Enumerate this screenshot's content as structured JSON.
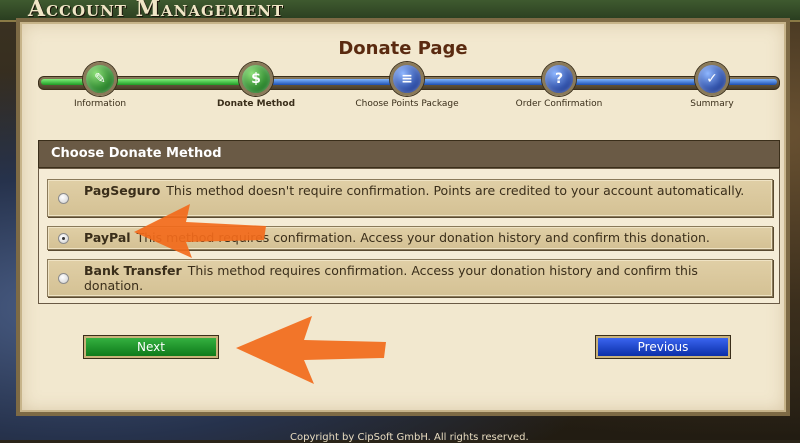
{
  "app": {
    "banner_title": "Account Management"
  },
  "page": {
    "title": "Donate Page"
  },
  "steps": [
    {
      "label": "Information",
      "icon": "quill-icon",
      "active": false
    },
    {
      "label": "Donate Method",
      "icon": "coin-icon",
      "active": true
    },
    {
      "label": "Choose Points Package",
      "icon": "scroll-icon",
      "active": false
    },
    {
      "label": "Order Confirmation",
      "icon": "question-icon",
      "active": false
    },
    {
      "label": "Summary",
      "icon": "checkmark-icon",
      "active": false
    }
  ],
  "progress": {
    "completed_steps": 2,
    "total_steps": 5
  },
  "section": {
    "title": "Choose Donate Method"
  },
  "options": [
    {
      "name": "PagSeguro",
      "description": "This method doesn't require confirmation. Points are credited to your account automatically.",
      "checked": false
    },
    {
      "name": "PayPal",
      "description": "This method requires confirmation. Access your donation history and confirm this donation.",
      "checked": true
    },
    {
      "name": "Bank Transfer",
      "description": "This method requires confirmation. Access your donation history and confirm this donation.",
      "checked": false
    }
  ],
  "buttons": {
    "next": "Next",
    "previous": "Previous"
  },
  "footer": {
    "text": "Copyright by CipSoft GmbH. All rights reserved."
  },
  "colors": {
    "accent_green": "#1f9a24",
    "accent_blue": "#1d4fb0",
    "annotation": "#f26a1b"
  }
}
